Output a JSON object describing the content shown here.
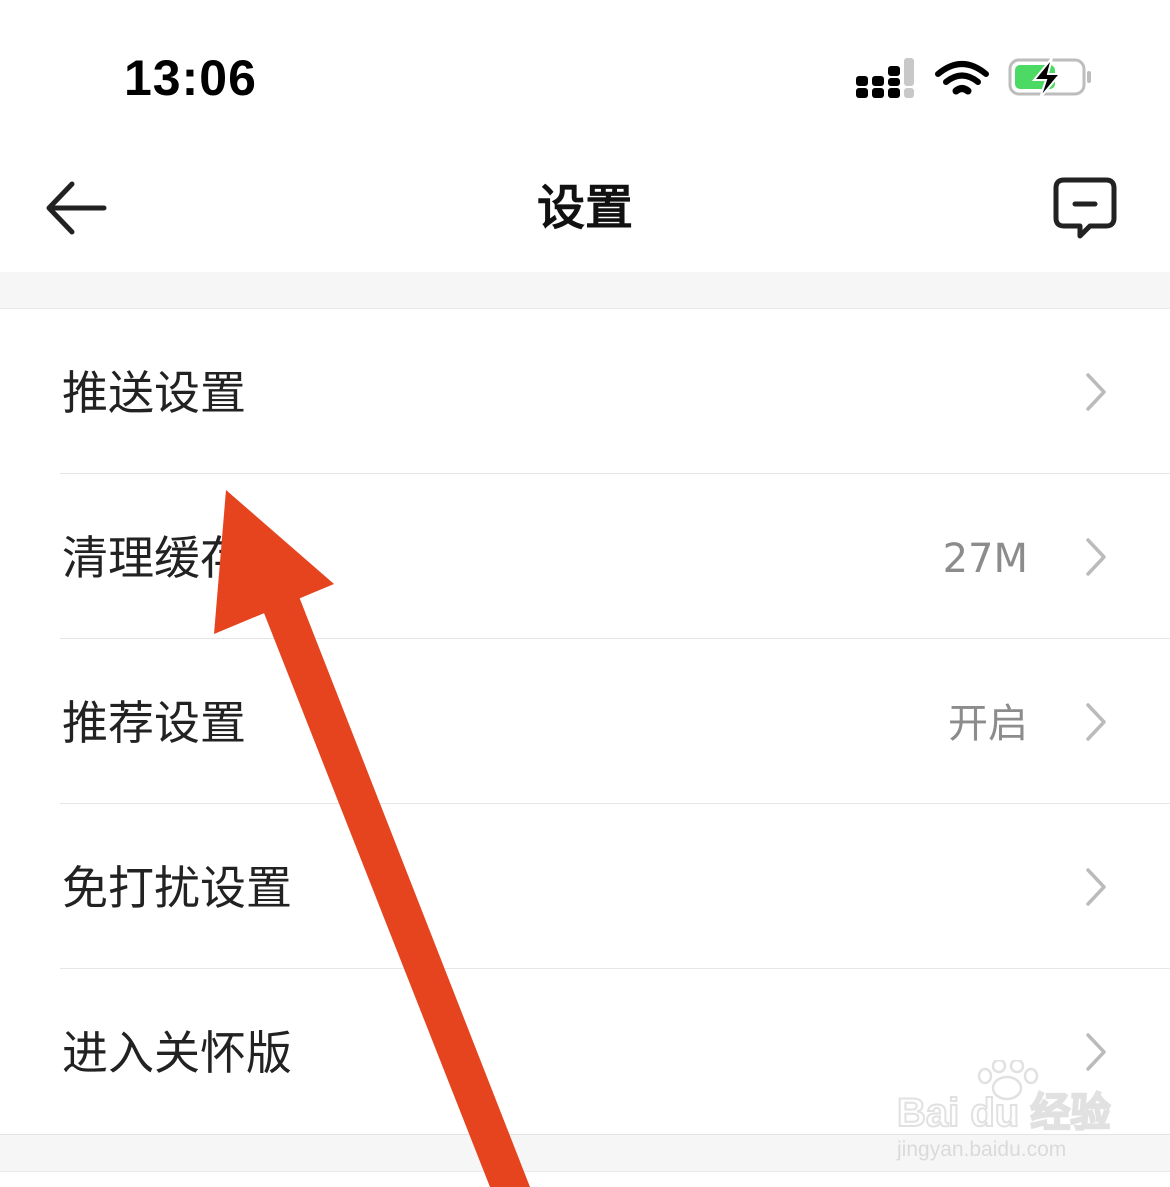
{
  "status_bar": {
    "time": "13:06",
    "icons": [
      "cellular-signal-icon",
      "wifi-icon",
      "battery-charging-icon"
    ],
    "battery_color": "#4cd964"
  },
  "nav": {
    "title": "设置",
    "back_icon": "back-arrow-icon",
    "feedback_icon": "feedback-message-icon"
  },
  "settings": {
    "items": [
      {
        "label": "推送设置",
        "value": ""
      },
      {
        "label": "清理缓存",
        "value": "27M"
      },
      {
        "label": "推荐设置",
        "value": "开启"
      },
      {
        "label": "免打扰设置",
        "value": ""
      },
      {
        "label": "进入关怀版",
        "value": ""
      }
    ]
  },
  "annotation": {
    "color": "#e5441f"
  },
  "watermark": {
    "brand": "Bai du 经验",
    "url": "jingyan.baidu.com"
  }
}
